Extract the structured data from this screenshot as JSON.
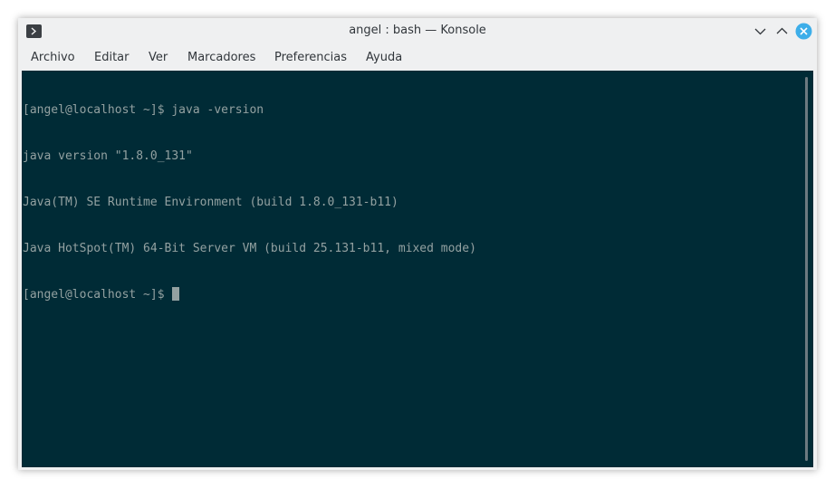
{
  "window": {
    "title": "angel : bash — Konsole"
  },
  "titlebar_icons": {
    "app": "konsole-icon",
    "minimize": "chevron-down-icon",
    "maximize": "chevron-up-icon",
    "close": "close-icon"
  },
  "menubar": {
    "items": [
      {
        "label": "Archivo"
      },
      {
        "label": "Editar"
      },
      {
        "label": "Ver"
      },
      {
        "label": "Marcadores"
      },
      {
        "label": "Preferencias"
      },
      {
        "label": "Ayuda"
      }
    ]
  },
  "terminal": {
    "lines": [
      "[angel@localhost ~]$ java -version",
      "java version \"1.8.0_131\"",
      "Java(TM) SE Runtime Environment (build 1.8.0_131-b11)",
      "Java HotSpot(TM) 64-Bit Server VM (build 25.131-b11, mixed mode)"
    ],
    "prompt": "[angel@localhost ~]$"
  },
  "colors": {
    "terminal_bg": "#002b36",
    "terminal_fg": "#93a1a1",
    "close_button": "#3daee9",
    "chrome_bg": "#eff0f1"
  }
}
